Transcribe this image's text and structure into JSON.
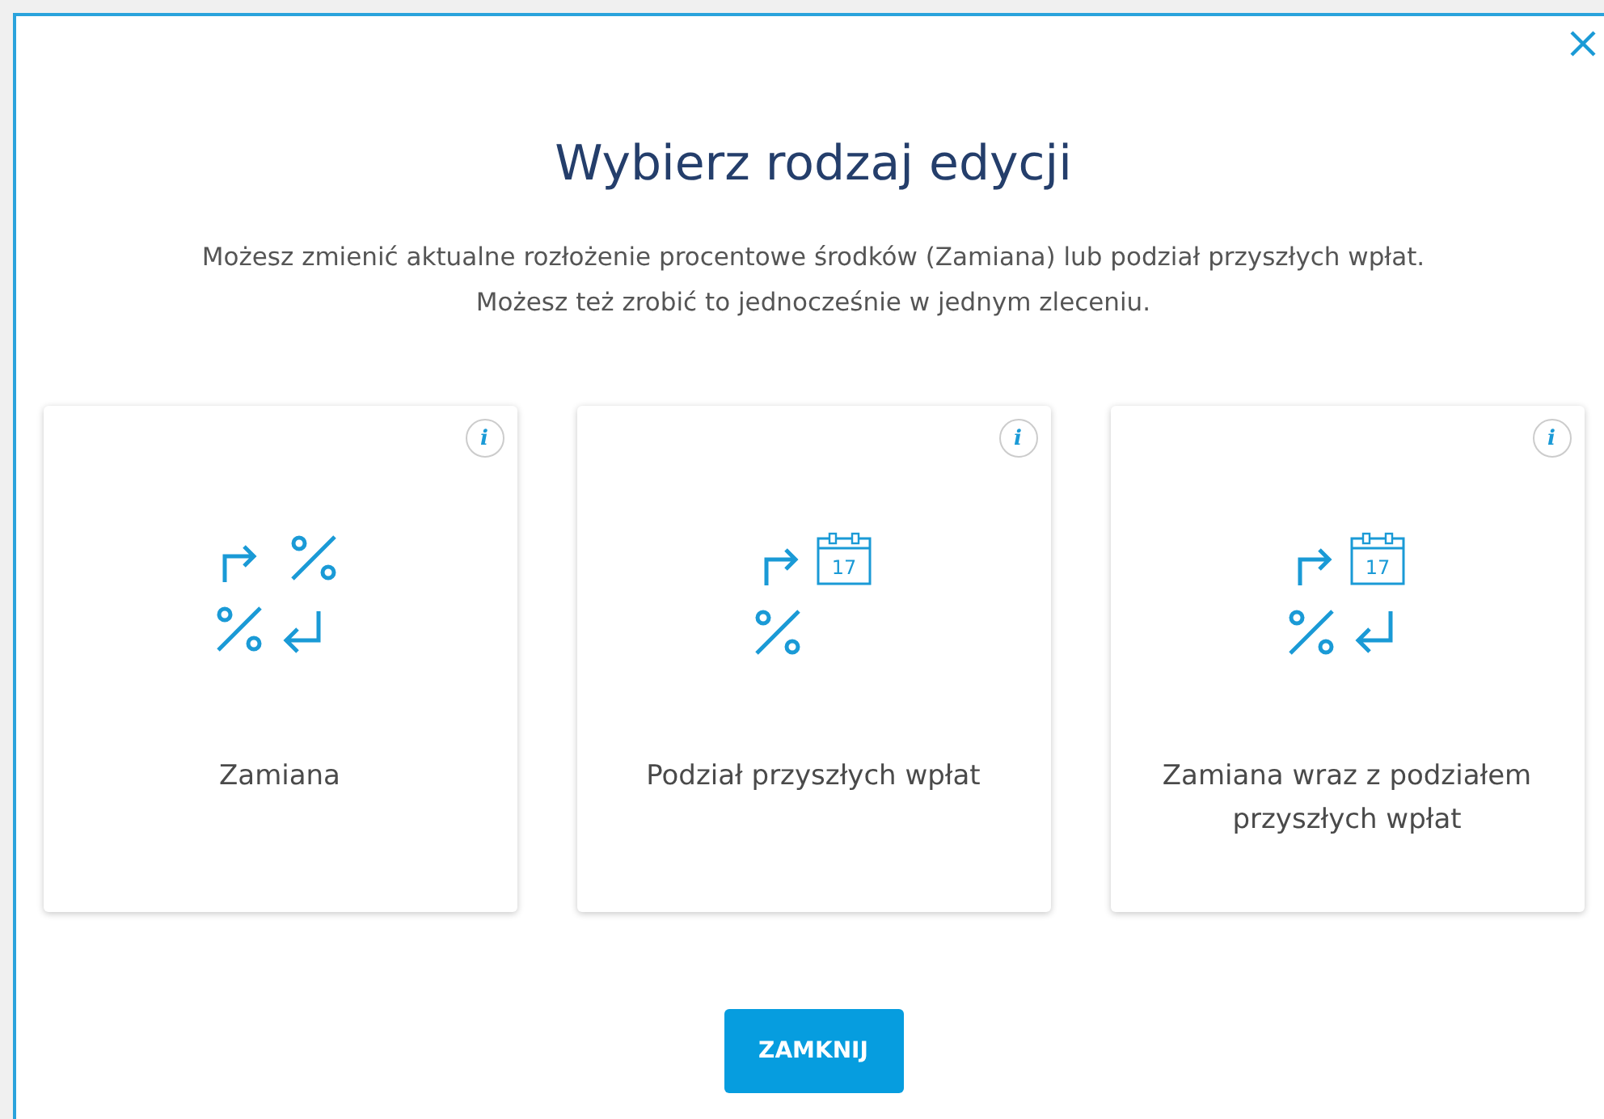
{
  "dialog": {
    "title": "Wybierz rodzaj edycji",
    "description": [
      "Możesz zmienić aktualne rozłożenie procentowe środków (Zamiana) lub podział przyszłych wpłat.",
      "Możesz też zrobić to jednocześnie w jednym zleceniu."
    ],
    "options": [
      {
        "kind": "swap",
        "info_label": "i",
        "label": "Zamiana"
      },
      {
        "kind": "future",
        "info_label": "i",
        "label": "Podział przyszłych wpłat",
        "calendar_day": "17"
      },
      {
        "kind": "both",
        "info_label": "i",
        "label": "Zamiana wraz z podziałem przyszłych wpłat",
        "calendar_day": "17"
      }
    ],
    "close_button": "ZAMKNIJ"
  }
}
